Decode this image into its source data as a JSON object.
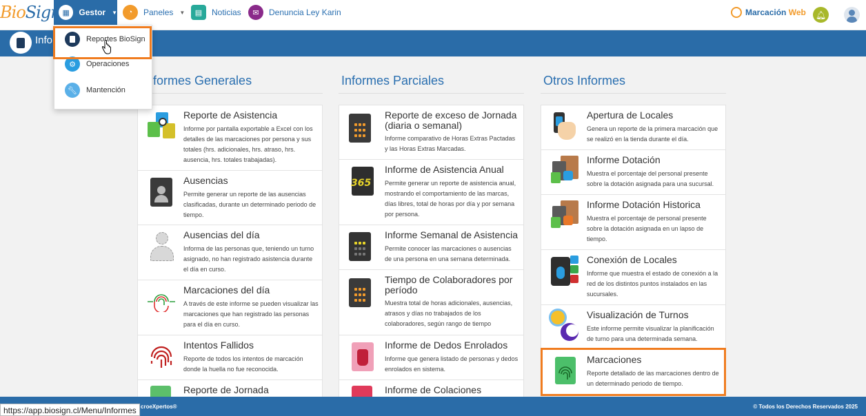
{
  "brand": {
    "logo_text_a": "Bio",
    "logo_text_b": "Sign"
  },
  "nav": {
    "gestor": "Gestor",
    "paneles": "Paneles",
    "noticias": "Noticias",
    "denuncia": "Denuncia Ley Karin",
    "marcacion_a": "Marcación",
    "marcacion_b": "Web"
  },
  "band": {
    "title": "Infor"
  },
  "dropdown": {
    "items": [
      {
        "label": "Reportes BioSign"
      },
      {
        "label": "Operaciones"
      },
      {
        "label": "Mantención"
      }
    ]
  },
  "columns": [
    {
      "title": "Informes Generales"
    },
    {
      "title": "Informes Parciales"
    },
    {
      "title": "Otros Informes"
    }
  ],
  "general": [
    {
      "title": "Reporte de Asistencia",
      "desc": "Informe por pantalla exportable a Excel con los detalles de las marcaciones por persona y sus totales (hrs. adicionales, hrs. atraso, hrs. ausencia, hrs. totales trabajadas)."
    },
    {
      "title": "Ausencias",
      "desc": "Permite generar un reporte de las ausencias clasificadas, durante un determinado periodo de tiempo."
    },
    {
      "title": "Ausencias del día",
      "desc": "Informa de las personas que, teniendo un turno asignado, no han registrado asistencia durante el día en curso."
    },
    {
      "title": "Marcaciones del día",
      "desc": "A través de este informe se pueden visualizar las marcaciones que han registrado las personas para el día en curso."
    },
    {
      "title": "Intentos Fallidos",
      "desc": "Reporte de todos los intentos de marcación donde la huella no fue reconocida."
    },
    {
      "title": "Reporte de Jornada",
      "desc": ""
    }
  ],
  "parcial": [
    {
      "title": "Reporte de exceso de Jornada (diaria o semanal)",
      "desc": "Informe comparativo de Horas Extras Pactadas y las Horas Extras Marcadas."
    },
    {
      "title": "Informe de Asistencia Anual",
      "desc": "Permite generar un reporte de asistencia anual, mostrando el comportamiento de las marcas, días libres, total de horas por día y por semana por persona.",
      "badge": "365"
    },
    {
      "title": "Informe Semanal de Asistencia",
      "desc": "Permite conocer las marcaciones o ausencias de una persona en una semana determinada."
    },
    {
      "title": "Tiempo de Colaboradores por período",
      "desc": "Muestra total de horas adicionales, ausencias, atrasos y días no trabajados de los colaboradores, según rango de tiempo"
    },
    {
      "title": "Informe de Dedos Enrolados",
      "desc": "Informe que genera listado de personas y dedos enrolados en sistema."
    },
    {
      "title": "Informe de Colaciones",
      "desc": ""
    }
  ],
  "otros": [
    {
      "title": "Apertura de Locales",
      "desc": "Genera un reporte de la primera marcación que se realizó en la tienda durante el día."
    },
    {
      "title": "Informe Dotación",
      "desc": "Muestra el porcentaje del personal presente sobre la dotación asignada para una sucursal."
    },
    {
      "title": "Informe Dotación Historica",
      "desc": "Muestra el porcentaje de personal presente sobre la dotación asignada en un lapso de tiempo."
    },
    {
      "title": "Conexión de Locales",
      "desc": "Informe que muestra el estado de conexión a la red de los distintos puntos instalados en las sucursales."
    },
    {
      "title": "Visualización de Turnos",
      "desc": "Este informe permite visualizar la planificación de turno para una determinada semana."
    },
    {
      "title": "Marcaciones",
      "desc": "Reporte detallado de las marcaciones dentro de un determinado periodo de tiempo."
    }
  ],
  "footer": {
    "left": "croeXpertos®",
    "right": "© Todos los Derechos Reservados 2025"
  },
  "status_url": "https://app.biosign.cl/Menu/Informes",
  "colors": {
    "primary": "#2a6ca8",
    "accent": "#f07c1f"
  }
}
